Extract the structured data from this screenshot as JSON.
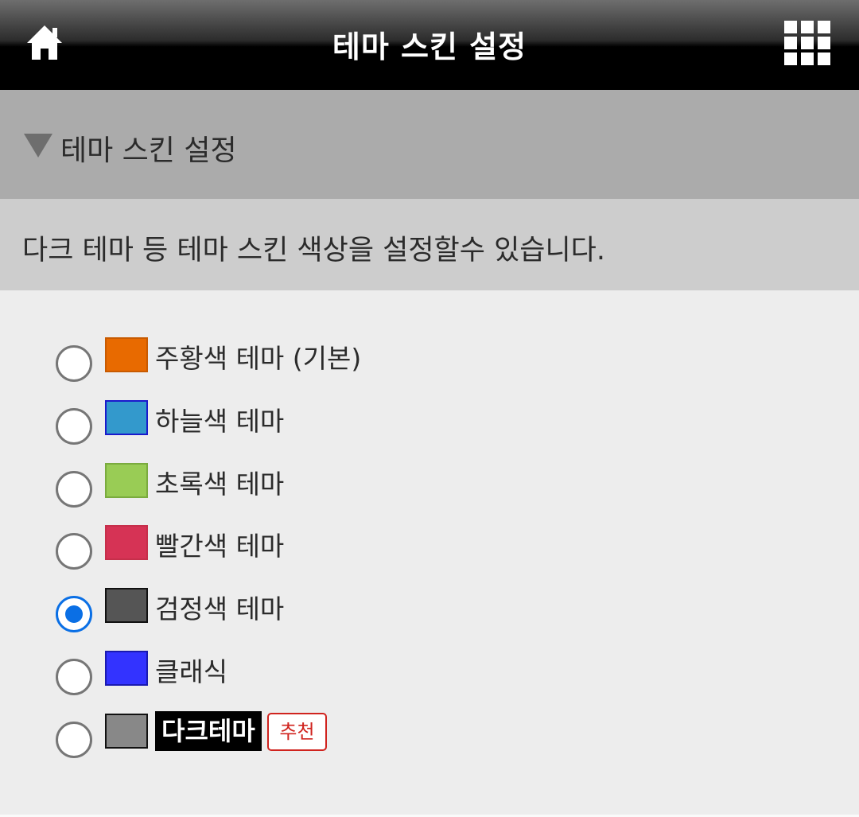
{
  "header": {
    "title": "테마 스킨 설정",
    "home_icon": "home-icon",
    "menu_icon": "grid-menu-icon"
  },
  "section": {
    "title": "테마 스킨 설정",
    "toggle_icon": "triangle-down-icon",
    "description": "다크 테마 등 테마 스킨 색상을 설정할수 있습니다."
  },
  "options": [
    {
      "label": "주황색 테마 (기본)",
      "color": "#e86a00",
      "border": "#c85a00",
      "checked": false
    },
    {
      "label": "하늘색 테마",
      "color": "#3399cc",
      "border": "#1a1acc",
      "checked": false
    },
    {
      "label": "초록색 테마",
      "color": "#99cc55",
      "border": "#7aab3e",
      "checked": false
    },
    {
      "label": "빨간색 테마",
      "color": "#d63355",
      "border": "#c62f4b",
      "checked": false
    },
    {
      "label": "검정색 테마",
      "color": "#555555",
      "border": "#111111",
      "checked": true
    },
    {
      "label": "클래식",
      "color": "#3333ff",
      "border": "#1a1ab0",
      "checked": false
    },
    {
      "label": "다크테마",
      "color": "#888888",
      "border": "#111111",
      "checked": false,
      "badge": "추천"
    }
  ],
  "colors": {
    "accent": "#0a6fe5",
    "badge": "#d0231e"
  }
}
